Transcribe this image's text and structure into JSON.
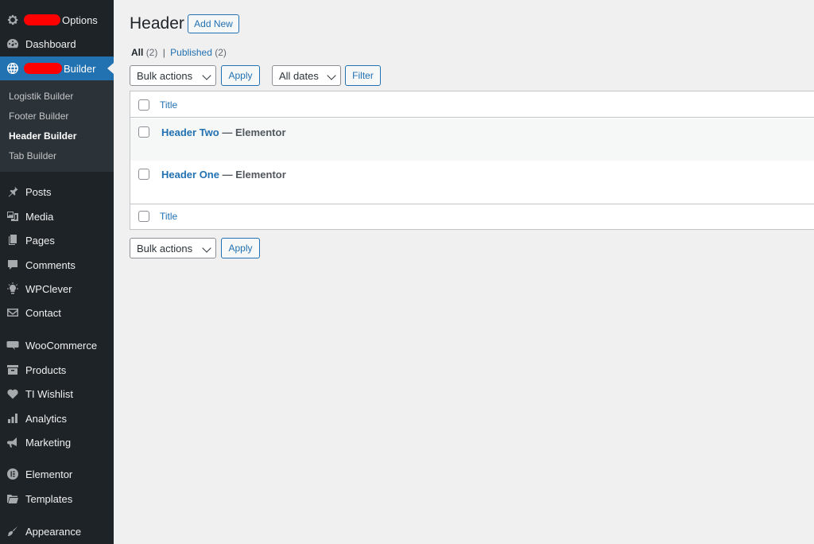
{
  "sidebar": {
    "top_item": {
      "label": "Options",
      "icon": "gear-icon"
    },
    "dashboard": {
      "label": "Dashboard",
      "icon": "dashboard-icon"
    },
    "current": {
      "label": "Builder",
      "icon": "globe-icon"
    },
    "submenu": [
      "Logistik Builder",
      "Footer Builder",
      "Header Builder",
      "Tab Builder"
    ],
    "items": [
      {
        "label": "Posts",
        "icon": "pin-icon"
      },
      {
        "label": "Media",
        "icon": "media-icon"
      },
      {
        "label": "Pages",
        "icon": "pages-icon"
      },
      {
        "label": "Comments",
        "icon": "comment-icon"
      },
      {
        "label": "WPClever",
        "icon": "bulb-icon"
      },
      {
        "label": "Contact",
        "icon": "mail-icon"
      },
      {
        "label": "WooCommerce",
        "icon": "woo-icon"
      },
      {
        "label": "Products",
        "icon": "archive-icon"
      },
      {
        "label": "TI Wishlist",
        "icon": "heart-icon"
      },
      {
        "label": "Analytics",
        "icon": "chart-icon"
      },
      {
        "label": "Marketing",
        "icon": "megaphone-icon"
      },
      {
        "label": "Elementor",
        "icon": "elementor-icon"
      },
      {
        "label": "Templates",
        "icon": "folder-icon"
      },
      {
        "label": "Appearance",
        "icon": "brush-icon"
      }
    ]
  },
  "header": {
    "title": "Header",
    "add_new": "Add New"
  },
  "status": {
    "all": "All",
    "all_count": "(2)",
    "separator": "|",
    "published": "Published",
    "published_count": "(2)"
  },
  "filters": {
    "bulk_actions": "Bulk actions",
    "apply": "Apply",
    "dates": "All dates",
    "filter": "Filter"
  },
  "table": {
    "column_title": "Title",
    "rows": [
      {
        "title": "Header Two",
        "state": " — Elementor"
      },
      {
        "title": "Header One",
        "state": " — Elementor"
      }
    ]
  },
  "colors": {
    "sidebar": "#1d2327",
    "accent": "#2271b1",
    "submenu": "#2c3338"
  }
}
